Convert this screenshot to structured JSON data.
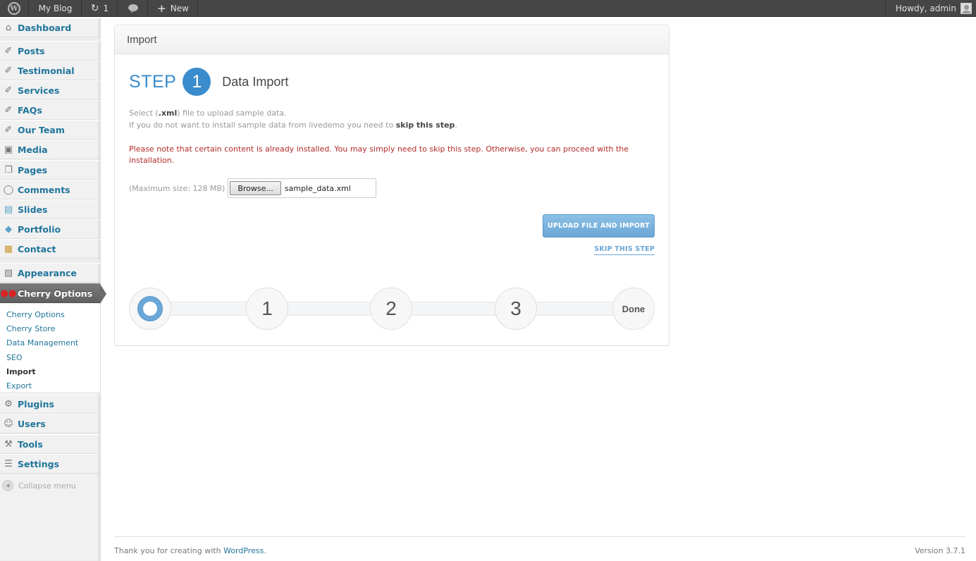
{
  "adminbar": {
    "logo_icon": "wordpress-icon",
    "blog_name": "My Blog",
    "updates_count": "1",
    "new_label": "New",
    "howdy": "Howdy, admin"
  },
  "sidebar": {
    "items": [
      {
        "label": "Dashboard",
        "icon": "home-icon"
      },
      {
        "label": "Posts",
        "icon": "pin-icon"
      },
      {
        "label": "Testimonial",
        "icon": "pin-icon"
      },
      {
        "label": "Services",
        "icon": "pin-icon"
      },
      {
        "label": "FAQs",
        "icon": "pin-icon"
      },
      {
        "label": "Our Team",
        "icon": "pin-icon"
      },
      {
        "label": "Media",
        "icon": "media-icon"
      },
      {
        "label": "Pages",
        "icon": "pages-icon"
      },
      {
        "label": "Comments",
        "icon": "comment-icon"
      },
      {
        "label": "Slides",
        "icon": "slides-icon"
      },
      {
        "label": "Portfolio",
        "icon": "portfolio-icon"
      },
      {
        "label": "Contact",
        "icon": "contact-icon"
      },
      {
        "label": "Appearance",
        "icon": "appearance-icon"
      },
      {
        "label": "Cherry Options",
        "icon": "cherry-icon"
      },
      {
        "label": "Plugins",
        "icon": "plugin-icon"
      },
      {
        "label": "Users",
        "icon": "users-icon"
      },
      {
        "label": "Tools",
        "icon": "tools-icon"
      },
      {
        "label": "Settings",
        "icon": "settings-icon"
      }
    ],
    "submenu": [
      "Cherry Options",
      "Cherry Store",
      "Data Management",
      "SEO",
      "Import",
      "Export"
    ],
    "collapse_label": "Collapse menu"
  },
  "panel": {
    "title": "Import",
    "step_word": "STEP",
    "step_number": "1",
    "step_name": "Data Import",
    "desc_line1_a": "Select (",
    "desc_line1_b": ".xml",
    "desc_line1_c": ") file to upload sample data.",
    "desc_line2_a": "If you do not want to install sample data from livedemo you need to ",
    "desc_line2_b": "skip this step",
    "desc_line2_c": ".",
    "note": "Please note that certain content is already installed. You may simply need to skip this step. Otherwise, you can proceed with the installation.",
    "max_size": "(Maximum size: 128 MB)",
    "browse_label": "Browse...",
    "file_name": "sample_data.xml",
    "upload_button": "UPLOAD FILE AND IMPORT",
    "skip_link": "SKIP THIS STEP",
    "progress_steps": [
      "1",
      "2",
      "3"
    ],
    "progress_done": "Done"
  },
  "footer": {
    "thanks_prefix": "Thank you for creating with ",
    "thanks_link": "WordPress",
    "thanks_suffix": ".",
    "version": "Version 3.7.1"
  },
  "colors": {
    "accent": "#3a8ccd",
    "link": "#21759b",
    "warning": "#b22b2b",
    "button": "#6aa6d6"
  }
}
